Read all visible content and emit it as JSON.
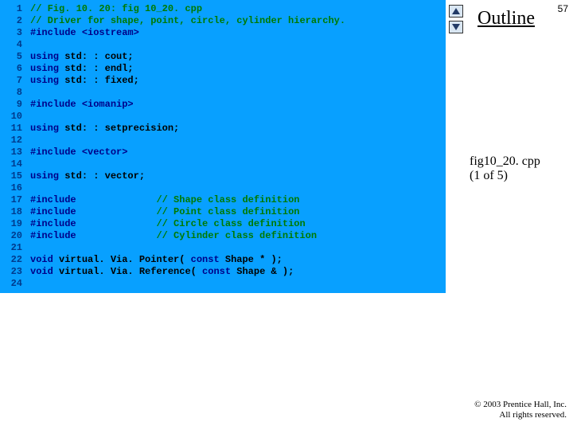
{
  "page_number": "57",
  "outline_label": "Outline",
  "file_caption_line1": "fig10_20. cpp",
  "file_caption_line2": "(1 of 5)",
  "copyright_line1": "© 2003 Prentice Hall, Inc.",
  "copyright_line2": "All rights reserved.",
  "code": {
    "lines": [
      {
        "n": "1",
        "segs": [
          {
            "cls": "c-comment",
            "t": "// Fig. 10. 20: fig 10_20. cpp"
          }
        ]
      },
      {
        "n": "2",
        "segs": [
          {
            "cls": "c-comment",
            "t": "// Driver for shape, point, circle, cylinder hierarchy."
          }
        ]
      },
      {
        "n": "3",
        "segs": [
          {
            "cls": "c-kw",
            "t": "#include "
          },
          {
            "cls": "c-kw",
            "t": "<iostream>"
          }
        ]
      },
      {
        "n": "4",
        "segs": [
          {
            "cls": "",
            "t": ""
          }
        ]
      },
      {
        "n": "5",
        "segs": [
          {
            "cls": "c-kw",
            "t": "using "
          },
          {
            "cls": "",
            "t": "std: : cout;"
          }
        ]
      },
      {
        "n": "6",
        "segs": [
          {
            "cls": "c-kw",
            "t": "using "
          },
          {
            "cls": "",
            "t": "std: : endl;"
          }
        ]
      },
      {
        "n": "7",
        "segs": [
          {
            "cls": "c-kw",
            "t": "using "
          },
          {
            "cls": "",
            "t": "std: : fixed;"
          }
        ]
      },
      {
        "n": "8",
        "segs": [
          {
            "cls": "",
            "t": ""
          }
        ]
      },
      {
        "n": "9",
        "segs": [
          {
            "cls": "c-kw",
            "t": "#include "
          },
          {
            "cls": "c-kw",
            "t": "<iomanip>"
          }
        ]
      },
      {
        "n": "10",
        "segs": [
          {
            "cls": "",
            "t": ""
          }
        ]
      },
      {
        "n": "11",
        "segs": [
          {
            "cls": "c-kw",
            "t": "using "
          },
          {
            "cls": "",
            "t": "std: : setprecision;"
          }
        ]
      },
      {
        "n": "12",
        "segs": [
          {
            "cls": "",
            "t": ""
          }
        ]
      },
      {
        "n": "13",
        "segs": [
          {
            "cls": "c-kw",
            "t": "#include "
          },
          {
            "cls": "c-kw",
            "t": "<vector>"
          }
        ]
      },
      {
        "n": "14",
        "segs": [
          {
            "cls": "",
            "t": ""
          }
        ]
      },
      {
        "n": "15",
        "segs": [
          {
            "cls": "c-kw",
            "t": "using "
          },
          {
            "cls": "",
            "t": "std: : vector;"
          }
        ]
      },
      {
        "n": "16",
        "segs": [
          {
            "cls": "",
            "t": ""
          }
        ]
      },
      {
        "n": "17",
        "segs": [
          {
            "cls": "c-kw",
            "t": "#include              "
          },
          {
            "cls": "c-comment",
            "t": "// Shape class definition"
          }
        ]
      },
      {
        "n": "18",
        "segs": [
          {
            "cls": "c-kw",
            "t": "#include              "
          },
          {
            "cls": "c-comment",
            "t": "// Point class definition"
          }
        ]
      },
      {
        "n": "19",
        "segs": [
          {
            "cls": "c-kw",
            "t": "#include              "
          },
          {
            "cls": "c-comment",
            "t": "// Circle class definition"
          }
        ]
      },
      {
        "n": "20",
        "segs": [
          {
            "cls": "c-kw",
            "t": "#include              "
          },
          {
            "cls": "c-comment",
            "t": "// Cylinder class definition"
          }
        ]
      },
      {
        "n": "21",
        "segs": [
          {
            "cls": "",
            "t": ""
          }
        ]
      },
      {
        "n": "22",
        "segs": [
          {
            "cls": "c-kw",
            "t": "void "
          },
          {
            "cls": "",
            "t": "virtual. Via. Pointer( "
          },
          {
            "cls": "c-kw",
            "t": "const "
          },
          {
            "cls": "",
            "t": "Shape * );"
          }
        ]
      },
      {
        "n": "23",
        "segs": [
          {
            "cls": "c-kw",
            "t": "void "
          },
          {
            "cls": "",
            "t": "virtual. Via. Reference( "
          },
          {
            "cls": "c-kw",
            "t": "const "
          },
          {
            "cls": "",
            "t": "Shape & );"
          }
        ]
      },
      {
        "n": "24",
        "segs": [
          {
            "cls": "",
            "t": ""
          }
        ]
      }
    ]
  }
}
